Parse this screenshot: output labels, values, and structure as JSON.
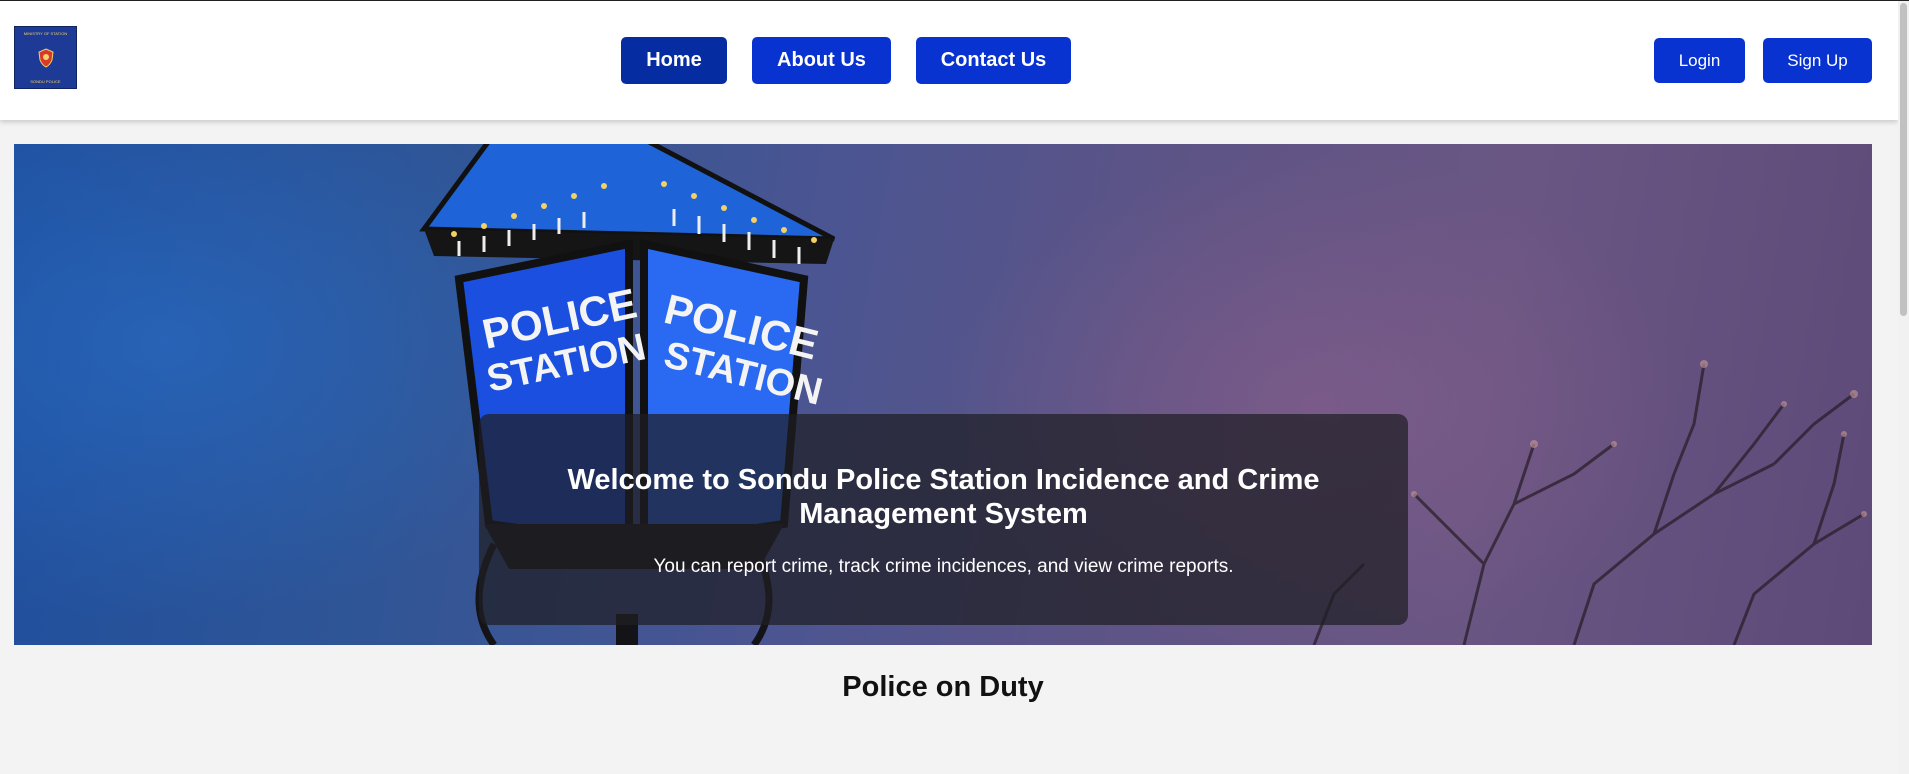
{
  "header": {
    "logo": {
      "top_text": "MINISTRY OF STATION",
      "bottom_text": "SONDU POLICE"
    },
    "nav": [
      {
        "label": "Home",
        "active": true
      },
      {
        "label": "About Us",
        "active": false
      },
      {
        "label": "Contact Us",
        "active": false
      }
    ],
    "auth": {
      "login_label": "Login",
      "signup_label": "Sign Up"
    }
  },
  "hero": {
    "title": "Welcome to Sondu Police Station Incidence and Crime Management System",
    "subtitle": "You can report crime, track crime incidences, and view crime reports.",
    "lamp_sign_text_line1": "POLICE",
    "lamp_sign_text_line2": "STATION"
  },
  "section": {
    "title": "Police on Duty"
  },
  "colors": {
    "primary_button": "#0833d0",
    "active_button": "#052ca0",
    "overlay": "rgba(30,30,36,0.72)",
    "page_bg": "#f3f3f3"
  }
}
